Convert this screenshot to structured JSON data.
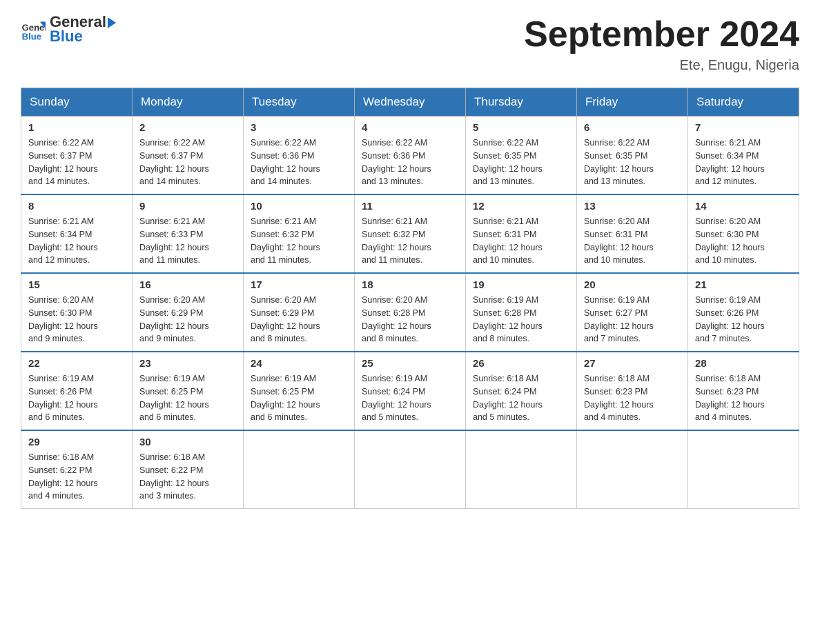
{
  "logo": {
    "text_general": "General",
    "text_blue": "Blue"
  },
  "title": "September 2024",
  "subtitle": "Ete, Enugu, Nigeria",
  "days_of_week": [
    "Sunday",
    "Monday",
    "Tuesday",
    "Wednesday",
    "Thursday",
    "Friday",
    "Saturday"
  ],
  "weeks": [
    [
      {
        "day": "1",
        "sunrise": "6:22 AM",
        "sunset": "6:37 PM",
        "daylight": "12 hours and 14 minutes."
      },
      {
        "day": "2",
        "sunrise": "6:22 AM",
        "sunset": "6:37 PM",
        "daylight": "12 hours and 14 minutes."
      },
      {
        "day": "3",
        "sunrise": "6:22 AM",
        "sunset": "6:36 PM",
        "daylight": "12 hours and 14 minutes."
      },
      {
        "day": "4",
        "sunrise": "6:22 AM",
        "sunset": "6:36 PM",
        "daylight": "12 hours and 13 minutes."
      },
      {
        "day": "5",
        "sunrise": "6:22 AM",
        "sunset": "6:35 PM",
        "daylight": "12 hours and 13 minutes."
      },
      {
        "day": "6",
        "sunrise": "6:22 AM",
        "sunset": "6:35 PM",
        "daylight": "12 hours and 13 minutes."
      },
      {
        "day": "7",
        "sunrise": "6:21 AM",
        "sunset": "6:34 PM",
        "daylight": "12 hours and 12 minutes."
      }
    ],
    [
      {
        "day": "8",
        "sunrise": "6:21 AM",
        "sunset": "6:34 PM",
        "daylight": "12 hours and 12 minutes."
      },
      {
        "day": "9",
        "sunrise": "6:21 AM",
        "sunset": "6:33 PM",
        "daylight": "12 hours and 11 minutes."
      },
      {
        "day": "10",
        "sunrise": "6:21 AM",
        "sunset": "6:32 PM",
        "daylight": "12 hours and 11 minutes."
      },
      {
        "day": "11",
        "sunrise": "6:21 AM",
        "sunset": "6:32 PM",
        "daylight": "12 hours and 11 minutes."
      },
      {
        "day": "12",
        "sunrise": "6:21 AM",
        "sunset": "6:31 PM",
        "daylight": "12 hours and 10 minutes."
      },
      {
        "day": "13",
        "sunrise": "6:20 AM",
        "sunset": "6:31 PM",
        "daylight": "12 hours and 10 minutes."
      },
      {
        "day": "14",
        "sunrise": "6:20 AM",
        "sunset": "6:30 PM",
        "daylight": "12 hours and 10 minutes."
      }
    ],
    [
      {
        "day": "15",
        "sunrise": "6:20 AM",
        "sunset": "6:30 PM",
        "daylight": "12 hours and 9 minutes."
      },
      {
        "day": "16",
        "sunrise": "6:20 AM",
        "sunset": "6:29 PM",
        "daylight": "12 hours and 9 minutes."
      },
      {
        "day": "17",
        "sunrise": "6:20 AM",
        "sunset": "6:29 PM",
        "daylight": "12 hours and 8 minutes."
      },
      {
        "day": "18",
        "sunrise": "6:20 AM",
        "sunset": "6:28 PM",
        "daylight": "12 hours and 8 minutes."
      },
      {
        "day": "19",
        "sunrise": "6:19 AM",
        "sunset": "6:28 PM",
        "daylight": "12 hours and 8 minutes."
      },
      {
        "day": "20",
        "sunrise": "6:19 AM",
        "sunset": "6:27 PM",
        "daylight": "12 hours and 7 minutes."
      },
      {
        "day": "21",
        "sunrise": "6:19 AM",
        "sunset": "6:26 PM",
        "daylight": "12 hours and 7 minutes."
      }
    ],
    [
      {
        "day": "22",
        "sunrise": "6:19 AM",
        "sunset": "6:26 PM",
        "daylight": "12 hours and 6 minutes."
      },
      {
        "day": "23",
        "sunrise": "6:19 AM",
        "sunset": "6:25 PM",
        "daylight": "12 hours and 6 minutes."
      },
      {
        "day": "24",
        "sunrise": "6:19 AM",
        "sunset": "6:25 PM",
        "daylight": "12 hours and 6 minutes."
      },
      {
        "day": "25",
        "sunrise": "6:19 AM",
        "sunset": "6:24 PM",
        "daylight": "12 hours and 5 minutes."
      },
      {
        "day": "26",
        "sunrise": "6:18 AM",
        "sunset": "6:24 PM",
        "daylight": "12 hours and 5 minutes."
      },
      {
        "day": "27",
        "sunrise": "6:18 AM",
        "sunset": "6:23 PM",
        "daylight": "12 hours and 4 minutes."
      },
      {
        "day": "28",
        "sunrise": "6:18 AM",
        "sunset": "6:23 PM",
        "daylight": "12 hours and 4 minutes."
      }
    ],
    [
      {
        "day": "29",
        "sunrise": "6:18 AM",
        "sunset": "6:22 PM",
        "daylight": "12 hours and 4 minutes."
      },
      {
        "day": "30",
        "sunrise": "6:18 AM",
        "sunset": "6:22 PM",
        "daylight": "12 hours and 3 minutes."
      },
      null,
      null,
      null,
      null,
      null
    ]
  ],
  "labels": {
    "sunrise": "Sunrise:",
    "sunset": "Sunset:",
    "daylight": "Daylight:"
  }
}
